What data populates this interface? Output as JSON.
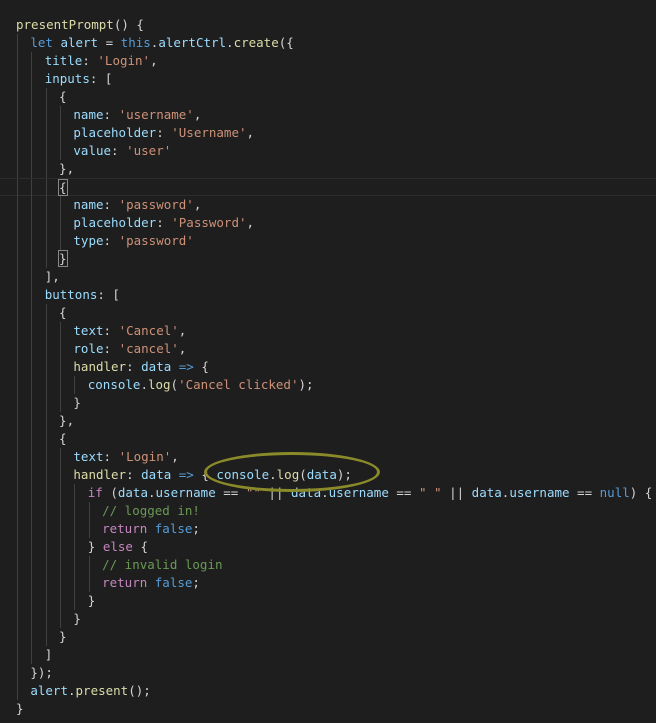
{
  "editor": {
    "lines": [
      {
        "indent": 1,
        "tokens": [
          [
            "fn",
            "presentPrompt"
          ],
          [
            "punc",
            "() {"
          ]
        ]
      },
      {
        "indent": 2,
        "tokens": [
          [
            "kw",
            "let "
          ],
          [
            "var",
            "alert"
          ],
          [
            "punc",
            " = "
          ],
          [
            "kw",
            "this"
          ],
          [
            "punc",
            "."
          ],
          [
            "var",
            "alertCtrl"
          ],
          [
            "punc",
            "."
          ],
          [
            "fn",
            "create"
          ],
          [
            "punc",
            "({"
          ]
        ]
      },
      {
        "indent": 3,
        "tokens": [
          [
            "var",
            "title"
          ],
          [
            "punc",
            ": "
          ],
          [
            "str",
            "'Login'"
          ],
          [
            "punc",
            ","
          ]
        ]
      },
      {
        "indent": 3,
        "tokens": [
          [
            "var",
            "inputs"
          ],
          [
            "punc",
            ": ["
          ]
        ]
      },
      {
        "indent": 4,
        "tokens": [
          [
            "punc",
            "{"
          ]
        ]
      },
      {
        "indent": 5,
        "tokens": [
          [
            "var",
            "name"
          ],
          [
            "punc",
            ": "
          ],
          [
            "str",
            "'username'"
          ],
          [
            "punc",
            ","
          ]
        ]
      },
      {
        "indent": 5,
        "tokens": [
          [
            "var",
            "placeholder"
          ],
          [
            "punc",
            ": "
          ],
          [
            "str",
            "'Username'"
          ],
          [
            "punc",
            ","
          ]
        ]
      },
      {
        "indent": 5,
        "tokens": [
          [
            "var",
            "value"
          ],
          [
            "punc",
            ": "
          ],
          [
            "str",
            "'user'"
          ]
        ]
      },
      {
        "indent": 4,
        "tokens": [
          [
            "punc",
            "},"
          ]
        ]
      },
      {
        "indent": 4,
        "current": true,
        "tokens": [
          [
            "match",
            "{"
          ]
        ]
      },
      {
        "indent": 5,
        "tokens": [
          [
            "var",
            "name"
          ],
          [
            "punc",
            ": "
          ],
          [
            "str",
            "'password'"
          ],
          [
            "punc",
            ","
          ]
        ]
      },
      {
        "indent": 5,
        "tokens": [
          [
            "var",
            "placeholder"
          ],
          [
            "punc",
            ": "
          ],
          [
            "str",
            "'Password'"
          ],
          [
            "punc",
            ","
          ]
        ]
      },
      {
        "indent": 5,
        "tokens": [
          [
            "var",
            "type"
          ],
          [
            "punc",
            ": "
          ],
          [
            "str",
            "'password'"
          ]
        ]
      },
      {
        "indent": 4,
        "tokens": [
          [
            "match",
            "}"
          ]
        ]
      },
      {
        "indent": 3,
        "tokens": [
          [
            "punc",
            "],"
          ]
        ]
      },
      {
        "indent": 3,
        "tokens": [
          [
            "var",
            "buttons"
          ],
          [
            "punc",
            ": ["
          ]
        ]
      },
      {
        "indent": 4,
        "tokens": [
          [
            "punc",
            "{"
          ]
        ]
      },
      {
        "indent": 5,
        "tokens": [
          [
            "var",
            "text"
          ],
          [
            "punc",
            ": "
          ],
          [
            "str",
            "'Cancel'"
          ],
          [
            "punc",
            ","
          ]
        ]
      },
      {
        "indent": 5,
        "tokens": [
          [
            "var",
            "role"
          ],
          [
            "punc",
            ": "
          ],
          [
            "str",
            "'cancel'"
          ],
          [
            "punc",
            ","
          ]
        ]
      },
      {
        "indent": 5,
        "tokens": [
          [
            "fn",
            "handler"
          ],
          [
            "punc",
            ": "
          ],
          [
            "var",
            "data"
          ],
          [
            "punc",
            " "
          ],
          [
            "kw",
            "=>"
          ],
          [
            "punc",
            " {"
          ]
        ]
      },
      {
        "indent": 6,
        "tokens": [
          [
            "var",
            "console"
          ],
          [
            "punc",
            "."
          ],
          [
            "fn",
            "log"
          ],
          [
            "punc",
            "("
          ],
          [
            "str",
            "'Cancel clicked'"
          ],
          [
            "punc",
            ");"
          ]
        ]
      },
      {
        "indent": 5,
        "tokens": [
          [
            "punc",
            "}"
          ]
        ]
      },
      {
        "indent": 4,
        "tokens": [
          [
            "punc",
            "},"
          ]
        ]
      },
      {
        "indent": 4,
        "tokens": [
          [
            "punc",
            "{"
          ]
        ]
      },
      {
        "indent": 5,
        "tokens": [
          [
            "var",
            "text"
          ],
          [
            "punc",
            ": "
          ],
          [
            "str",
            "'Login'"
          ],
          [
            "punc",
            ","
          ]
        ]
      },
      {
        "indent": 5,
        "tokens": [
          [
            "fn",
            "handler"
          ],
          [
            "punc",
            ": "
          ],
          [
            "var",
            "data"
          ],
          [
            "punc",
            " "
          ],
          [
            "kw",
            "=>"
          ],
          [
            "punc",
            " { "
          ],
          [
            "var",
            "console"
          ],
          [
            "punc",
            "."
          ],
          [
            "fn",
            "log"
          ],
          [
            "punc",
            "("
          ],
          [
            "var",
            "data"
          ],
          [
            "punc",
            ");"
          ]
        ]
      },
      {
        "indent": 6,
        "tokens": [
          [
            "ctl",
            "if"
          ],
          [
            "punc",
            " ("
          ],
          [
            "var",
            "data"
          ],
          [
            "punc",
            "."
          ],
          [
            "var",
            "username"
          ],
          [
            "punc",
            " == "
          ],
          [
            "str",
            "\"\""
          ],
          [
            "punc",
            " || "
          ],
          [
            "var",
            "data"
          ],
          [
            "punc",
            "."
          ],
          [
            "var",
            "username"
          ],
          [
            "punc",
            " == "
          ],
          [
            "str",
            "\" \""
          ],
          [
            "punc",
            " || "
          ],
          [
            "var",
            "data"
          ],
          [
            "punc",
            "."
          ],
          [
            "var",
            "username"
          ],
          [
            "punc",
            " == "
          ],
          [
            "kw",
            "null"
          ],
          [
            "punc",
            ") {"
          ]
        ]
      },
      {
        "indent": 7,
        "tokens": [
          [
            "cmt",
            "// logged in!"
          ]
        ]
      },
      {
        "indent": 7,
        "tokens": [
          [
            "ctl",
            "return "
          ],
          [
            "kw",
            "false"
          ],
          [
            "punc",
            ";"
          ]
        ]
      },
      {
        "indent": 6,
        "tokens": [
          [
            "punc",
            "} "
          ],
          [
            "ctl",
            "else"
          ],
          [
            "punc",
            " {"
          ]
        ]
      },
      {
        "indent": 7,
        "tokens": [
          [
            "cmt",
            "// invalid login"
          ]
        ]
      },
      {
        "indent": 7,
        "tokens": [
          [
            "ctl",
            "return "
          ],
          [
            "kw",
            "false"
          ],
          [
            "punc",
            ";"
          ]
        ]
      },
      {
        "indent": 6,
        "tokens": [
          [
            "punc",
            "}"
          ]
        ]
      },
      {
        "indent": 5,
        "tokens": [
          [
            "punc",
            "}"
          ]
        ]
      },
      {
        "indent": 4,
        "tokens": [
          [
            "punc",
            "}"
          ]
        ]
      },
      {
        "indent": 3,
        "tokens": [
          [
            "punc",
            "]"
          ]
        ]
      },
      {
        "indent": 2,
        "tokens": [
          [
            "punc",
            "});"
          ]
        ]
      },
      {
        "indent": 2,
        "tokens": [
          [
            "var",
            "alert"
          ],
          [
            "punc",
            "."
          ],
          [
            "fn",
            "present"
          ],
          [
            "punc",
            "();"
          ]
        ]
      },
      {
        "indent": 1,
        "tokens": [
          [
            "punc",
            "}"
          ]
        ]
      }
    ]
  },
  "colors": {
    "background": "#1e1e1e",
    "function": "#dcdcaa",
    "keyword": "#569cd6",
    "variable": "#9cdcfe",
    "string": "#ce9178",
    "comment": "#6a9955",
    "control": "#c586c0",
    "punctuation": "#d4d4d4",
    "annotation": "#8a8a2a"
  }
}
